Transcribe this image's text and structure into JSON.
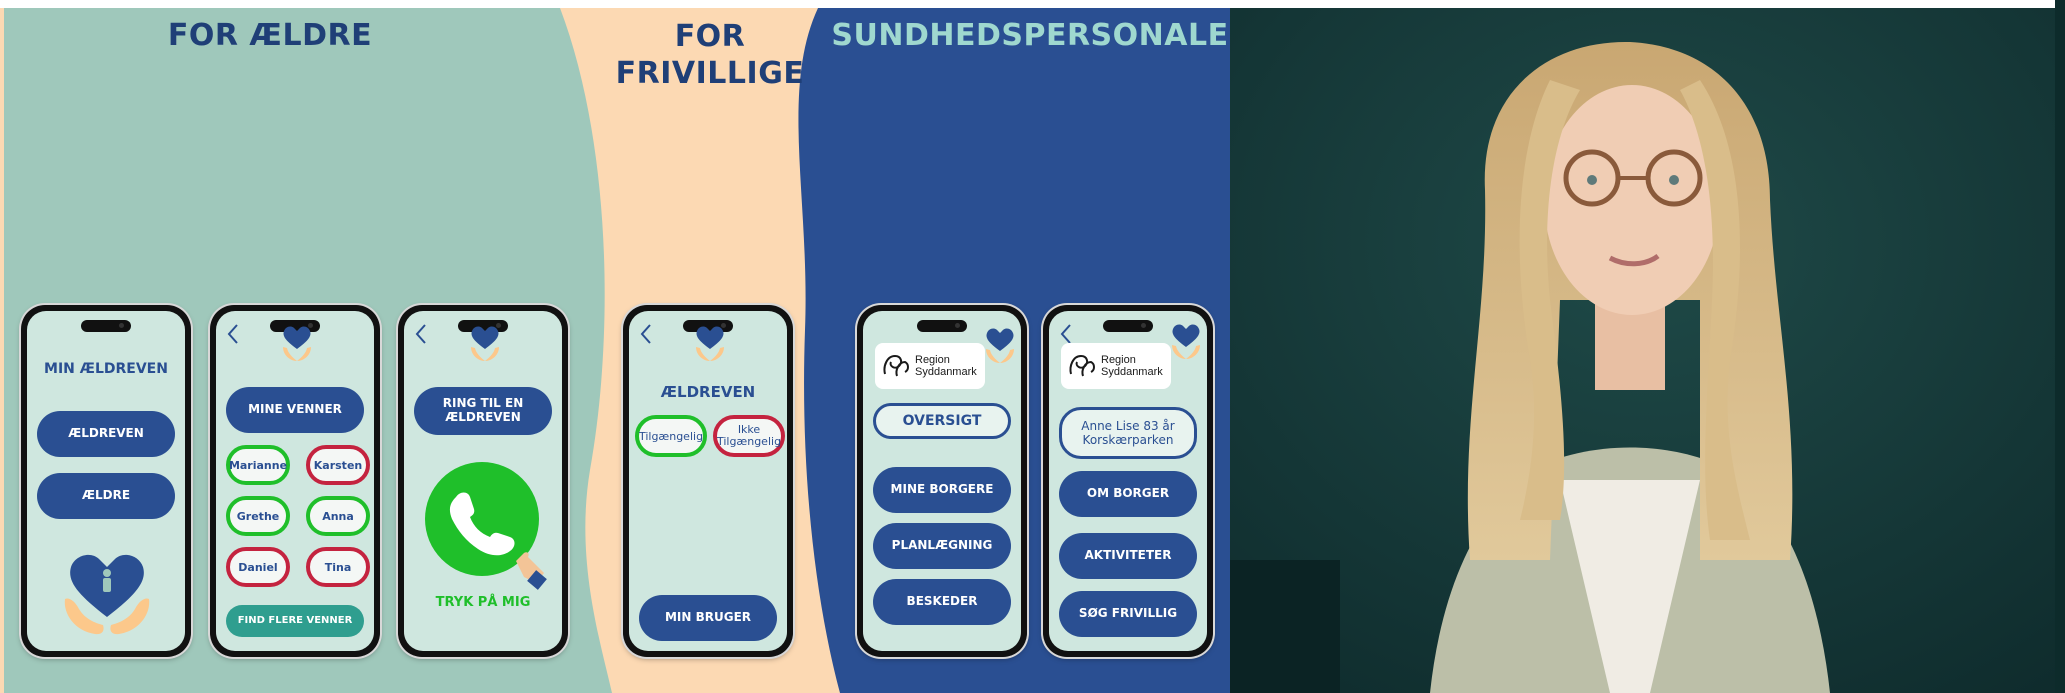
{
  "sections": {
    "aeldre_title": "FOR ÆLDRE",
    "frivillige_title_line1": "FOR",
    "frivillige_title_line2": "FRIVILLIGE",
    "sundhed_title": "SUNDHEDSPERSONALE"
  },
  "colors": {
    "sage": "#9fc8bb",
    "peach": "#fcd9b3",
    "navy": "#2a4f92",
    "pill_blue": "#2a4f92",
    "teal": "#2f9e8f",
    "green": "#1fbf2a",
    "red": "#c4233f",
    "photo_bg": "#173a3a"
  },
  "phone1": {
    "title": "MIN ÆLDREVEN",
    "btn1": "ÆLDREVEN",
    "btn2": "ÆLDRE",
    "icon": "heart-hands-icon"
  },
  "phone2": {
    "header_btn": "MINE VENNER",
    "friends": [
      {
        "name": "Marianne",
        "status": "green"
      },
      {
        "name": "Karsten",
        "status": "red"
      },
      {
        "name": "Grethe",
        "status": "green"
      },
      {
        "name": "Anna",
        "status": "green"
      },
      {
        "name": "Daniel",
        "status": "red"
      },
      {
        "name": "Tina",
        "status": "red"
      }
    ],
    "footer_btn": "FIND FLERE VENNER"
  },
  "phone3": {
    "call_line1": "RING TIL EN",
    "call_line2": "ÆLDREVEN",
    "tap_label": "TRYK PÅ MIG",
    "icon": "phone-call-icon"
  },
  "phone4": {
    "title": "ÆLDREVEN",
    "available": "Tilgængelig",
    "unavailable_line1": "Ikke",
    "unavailable_line2": "Tilgængelig",
    "bottom_btn": "MIN BRUGER"
  },
  "phone5": {
    "logo_line1": "Region",
    "logo_line2": "Syddanmark",
    "overview": "OVERSIGT",
    "btn1": "MINE BORGERE",
    "btn2": "PLANLÆGNING",
    "btn3": "BESKEDER"
  },
  "phone6": {
    "logo_line1": "Region",
    "logo_line2": "Syddanmark",
    "citizen_line1": "Anne Lise 83 år",
    "citizen_line2": "Korskærparken",
    "btn1": "OM BORGER",
    "btn2": "AKTIVITETER",
    "btn3": "SØG FRIVILLIG"
  },
  "photo": {
    "subject": "portrait-photo"
  }
}
